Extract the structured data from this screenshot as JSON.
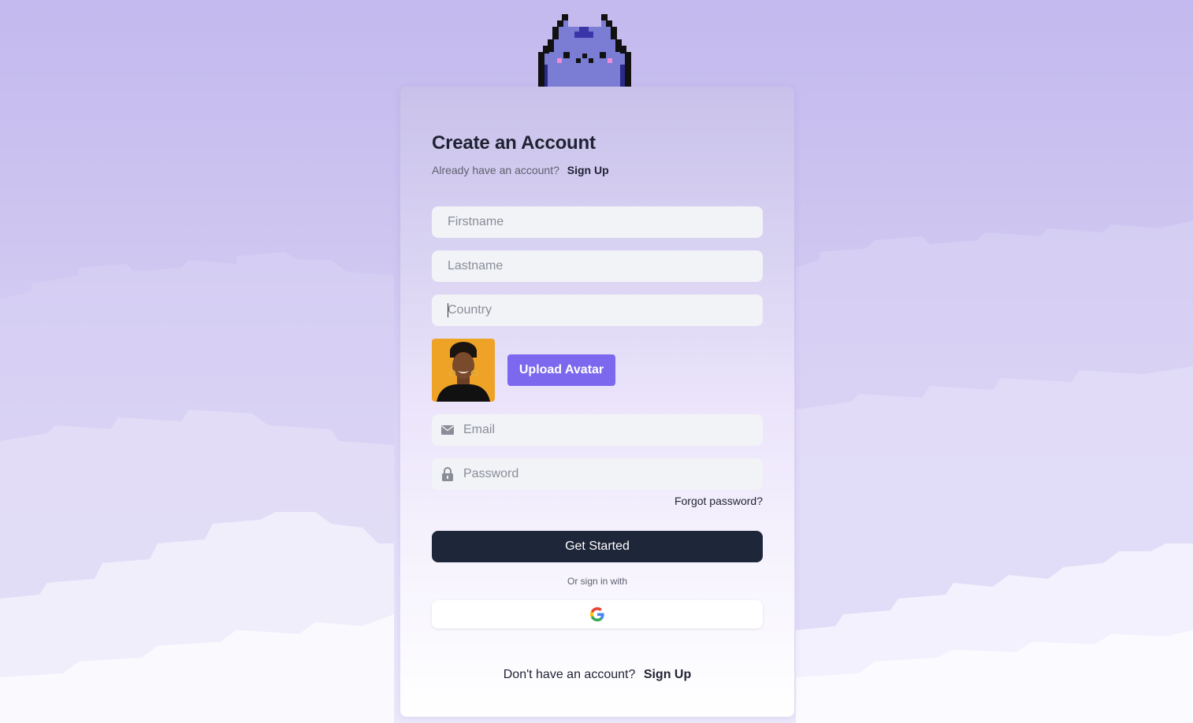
{
  "form": {
    "title": "Create an Account",
    "already_text": "Already have an account?",
    "already_link": "Sign Up",
    "firstname_placeholder": "Firstname",
    "lastname_placeholder": "Lastname",
    "country_placeholder": "Country",
    "upload_label": "Upload Avatar",
    "email_placeholder": "Email",
    "password_placeholder": "Password",
    "forgot_label": "Forgot password?",
    "submit_label": "Get Started",
    "or_text": "Or sign in with",
    "footer_text": "Don't have an account?",
    "footer_link": "Sign Up"
  },
  "icons": {
    "email": "mail-icon",
    "password": "lock-icon",
    "social": "google-icon",
    "logo": "pixel-cat-logo"
  },
  "colors": {
    "accent": "#7b68ee",
    "primary_button": "#1e2639",
    "input_bg": "#f2f3f7",
    "mascot": "#7b7dd4"
  }
}
